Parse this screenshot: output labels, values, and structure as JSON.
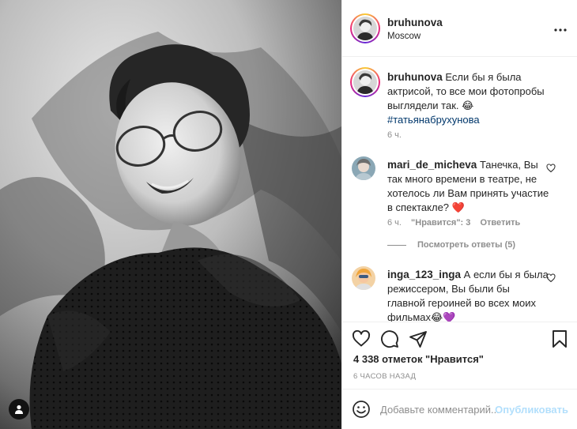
{
  "post": {
    "username": "bruhunova",
    "location": "Moscow"
  },
  "caption": {
    "username": "bruhunova",
    "text": "Если бы я была актрисой, то все мои фотопробы выглядели так. 😂",
    "hashtag": "#татьянабрухунова",
    "time": "6 ч."
  },
  "comments": [
    {
      "username": "mari_de_micheva",
      "text": "Танечка, Вы так много времени в театре, не хотелось ли Вам принять участие в спектакле? ❤️",
      "time": "6 ч.",
      "likes": "\"Нравится\": 3",
      "reply_label": "Ответить",
      "view_replies": "Посмотреть ответы (5)"
    },
    {
      "username": "inga_123_inga",
      "text": "А если бы я была режиссером, Вы были бы главной героиней во всех моих фильмах😂💜"
    }
  ],
  "stats": {
    "likes": "4 338 отметок \"Нравится\"",
    "time_ago": "6 ЧАСОВ НАЗАД"
  },
  "add_comment": {
    "placeholder": "Добавьте комментарий...",
    "publish_label": "Опубликовать"
  },
  "icons": {
    "more": "more-horizontal-icon",
    "like": "heart-icon",
    "comment": "comment-icon",
    "share": "paper-plane-icon",
    "save": "bookmark-icon",
    "emoji": "smiley-icon",
    "user_tag": "user-icon"
  },
  "colors": {
    "text": "#262626",
    "muted": "#8e8e8e",
    "hashtag": "#00376b",
    "publish_disabled": "#b2dffc",
    "border": "#efefef"
  }
}
